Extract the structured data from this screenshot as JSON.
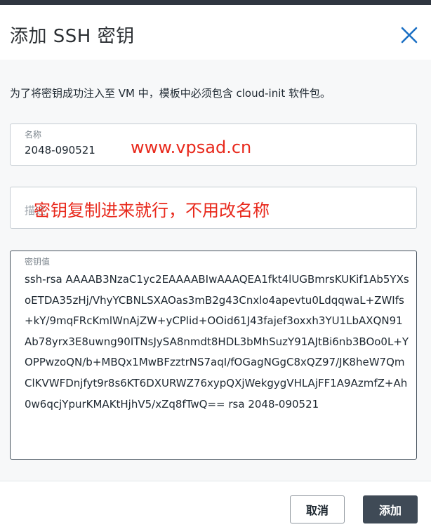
{
  "dialog": {
    "title": "添加 SSH 密钥",
    "close_icon": "close-icon",
    "intro": "为了将密钥成功注入至 VM 中，模板中必须包含 cloud-init 软件包。"
  },
  "fields": {
    "name": {
      "label": "名称",
      "value": "2048-090521"
    },
    "description": {
      "placeholder": "描述"
    },
    "key": {
      "label": "密钥值",
      "value": "ssh-rsa AAAAB3NzaC1yc2EAAAABIwAAAQEA1fkt4lUGBmrsKUKif1Ab5YXsoETDA35zHj/VhyYCBNLSXAOas3mB2g43Cnxlo4apevtu0LdqqwaL+ZWIfs+kY/9mqFRcKmlWnAjZW+yCPlid+OOid61J43fajef3oxxh3YU1LbAXQN91Ab78yrx3E8uwng90ITNsJySA8nmdt8HDL3bMhSuzY91AJtBi6nb3BOo0L+YOPPwzoQN/b+MBQx1MwBFzztrNS7aqI/fOGagNGgC8xQZ97/JK8heW7QmClKVWFDnjfyt9r8s6KT6DXURWZ76xypQXjWekgygVHLAjFF1A9AzmfZ+Ah0w6qcjYpurKMAKtHjhV5/xZq8fTwQ== rsa 2048-090521"
    }
  },
  "watermarks": {
    "site": "www.vpsad.cn",
    "note": "密钥复制进来就行，不用改名称"
  },
  "buttons": {
    "cancel": "取消",
    "add": "添加"
  },
  "colors": {
    "top_bar": "#2f3640",
    "primary_button": "#3f4a56",
    "body_background": "#f7f8f9",
    "close_icon": "#1a6fc4",
    "watermark": "#e8291c"
  }
}
